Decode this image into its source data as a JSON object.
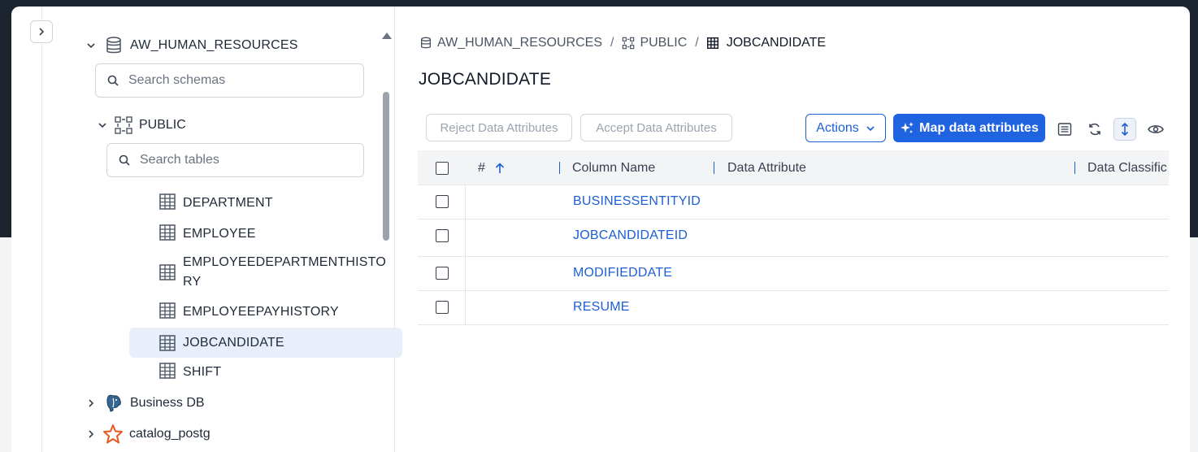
{
  "sidebar": {
    "database": {
      "name": "AW_HUMAN_RESOURCES",
      "search_placeholder": "Search schemas"
    },
    "schema": {
      "name": "PUBLIC",
      "search_placeholder": "Search tables"
    },
    "tables": [
      {
        "label": "DEPARTMENT",
        "selected": false
      },
      {
        "label": "EMPLOYEE",
        "selected": false
      },
      {
        "label": "EMPLOYEEDEPARTMENTHISTORY",
        "selected": false
      },
      {
        "label": "EMPLOYEEPAYHISTORY",
        "selected": false
      },
      {
        "label": "JOBCANDIDATE",
        "selected": true
      },
      {
        "label": "SHIFT",
        "selected": false
      }
    ],
    "other_sources": [
      {
        "label": "Business DB",
        "icon": "postgres-elephant-icon"
      },
      {
        "label": "catalog_postg",
        "icon": "star-icon"
      }
    ]
  },
  "breadcrumb": {
    "database": "AW_HUMAN_RESOURCES",
    "schema": "PUBLIC",
    "table": "JOBCANDIDATE",
    "separator": "/"
  },
  "page_title": "JOBCANDIDATE",
  "toolbar": {
    "reject_label": "Reject Data Attributes",
    "accept_label": "Accept Data Attributes",
    "actions_label": "Actions",
    "map_label": "Map data attributes"
  },
  "table": {
    "columns": [
      "#",
      "Column Name",
      "Data Attribute",
      "Data Classific"
    ],
    "rows": [
      {
        "column_name": "BUSINESSENTITYID"
      },
      {
        "column_name": "JOBCANDIDATEID"
      },
      {
        "column_name": "MODIFIEDDATE"
      },
      {
        "column_name": "RESUME"
      }
    ]
  },
  "colors": {
    "primary": "#1f63e0",
    "link": "#1d5fd6",
    "selected_bg": "#e8effa",
    "dark_bg": "#1c2430"
  }
}
